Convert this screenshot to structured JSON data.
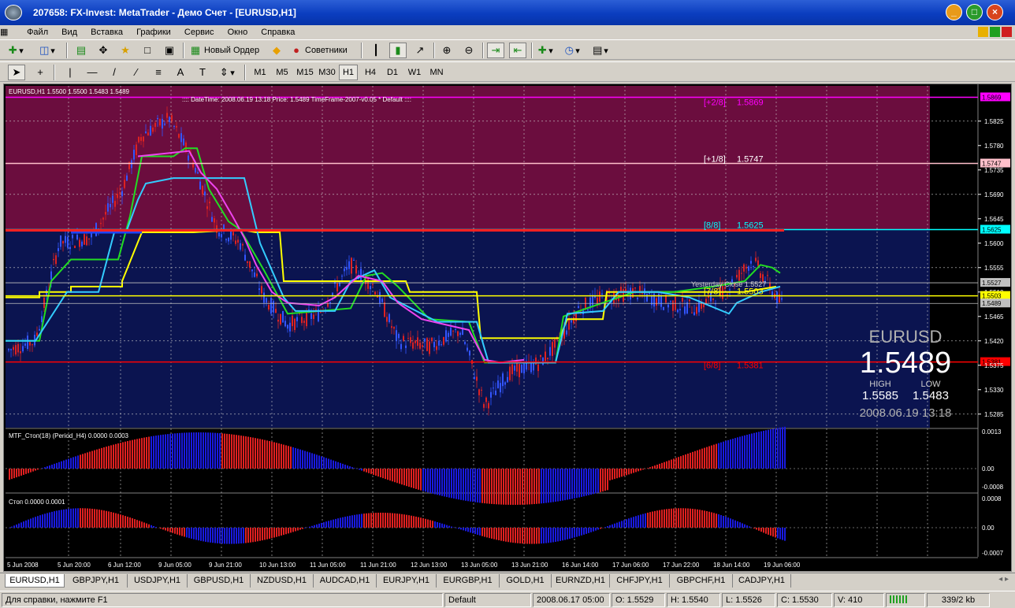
{
  "window": {
    "title": "207658: FX-Invest: MetaTrader - Демо Счет - [EURUSD,H1]"
  },
  "menu": [
    "Файл",
    "Вид",
    "Вставка",
    "Графики",
    "Сервис",
    "Окно",
    "Справка"
  ],
  "toolbar1": {
    "new_order": "Новый Ордер",
    "experts": "Советники"
  },
  "timeframes": [
    "M1",
    "M5",
    "M15",
    "M30",
    "H1",
    "H4",
    "D1",
    "W1",
    "MN"
  ],
  "active_timeframe": "H1",
  "chart": {
    "header": "EURUSD,H1  1.5500 1.5500 1.5483 1.5489",
    "info": ":::: DateTime: 2008.06.19 13:18   Price: 1.5489   TimeFrame-2007-v0.05   *  Default  ::::",
    "price_scale": [
      "1.5869",
      "1.5825",
      "1.5780",
      "1.5747",
      "1.5735",
      "1.5690",
      "1.5645",
      "1.5625",
      "1.5600",
      "1.5555",
      "1.5527",
      "1.5510",
      "1.5503",
      "1.5489",
      "1.5465",
      "1.5420",
      "1.5381",
      "1.5375",
      "1.5330",
      "1.5285"
    ],
    "levels": [
      {
        "label": "[+2/8]",
        "value": "1.5869",
        "color": "#ff00ff"
      },
      {
        "label": "[+1/8]",
        "value": "1.5747",
        "color": "#ffc0cb"
      },
      {
        "label": "[8/8]",
        "value": "1.5625",
        "color": "#00ffff"
      },
      {
        "label": "[7/8]",
        "value": "1.5503",
        "color": "#ffff00"
      },
      {
        "label": "[6/8]",
        "value": "1.5381",
        "color": "#ff0000"
      }
    ],
    "yesterday_close": "Yesterday Close 1.5527",
    "symbol": "EURUSD",
    "price": "1.5489",
    "high_label": "HIGH",
    "low_label": "LOW",
    "high": "1.5585",
    "low": "1.5483",
    "datetime": "2008.06.19 13:18",
    "badges": [
      "1.5869",
      "1.5747",
      "1.5625",
      "1.5527",
      "1.5503",
      "1.5489",
      "1.5381"
    ]
  },
  "indicator1": {
    "label": "MTF_Стоп(18) (Period_H4) 0.0000 0.0003",
    "scale": [
      "0.0013",
      "0.00",
      "-0.0008"
    ]
  },
  "indicator2": {
    "label": "Стоп 0.0000 0.0001",
    "scale": [
      "0.0008",
      "0.00",
      "-0.0007"
    ]
  },
  "time_axis": [
    "5 Jun 2008",
    "5 Jun 20:00",
    "6 Jun 12:00",
    "9 Jun 05:00",
    "9 Jun 21:00",
    "10 Jun 13:00",
    "11 Jun 05:00",
    "11 Jun 21:00",
    "12 Jun 13:00",
    "13 Jun 05:00",
    "13 Jun 21:00",
    "16 Jun 14:00",
    "17 Jun 06:00",
    "17 Jun 22:00",
    "18 Jun 14:00",
    "19 Jun 06:00"
  ],
  "tabs": [
    "EURUSD,H1",
    "GBPJPY,H1",
    "USDJPY,H1",
    "GBPUSD,H1",
    "NZDUSD,H1",
    "AUDCAD,H1",
    "EURJPY,H1",
    "EURGBP,H1",
    "GOLD,H1",
    "EURNZD,H1",
    "CHFJPY,H1",
    "GBPCHF,H1",
    "CADJPY,H1"
  ],
  "active_tab": "EURUSD,H1",
  "status": {
    "help": "Для справки, нажмите F1",
    "profile": "Default",
    "bar_time": "2008.06.17 05:00",
    "open": "O: 1.5529",
    "high": "H: 1.5540",
    "low": "L: 1.5526",
    "close": "C: 1.5530",
    "volume": "V: 410",
    "traffic": "339/2 kb"
  },
  "colors": {
    "upper_zone": "#6b0d3e",
    "lower_zone": "#0b1450",
    "candle_up": "#3355ff",
    "candle_down": "#dd2222",
    "hist_red": "#e02020",
    "hist_blue": "#1a1ae0"
  }
}
